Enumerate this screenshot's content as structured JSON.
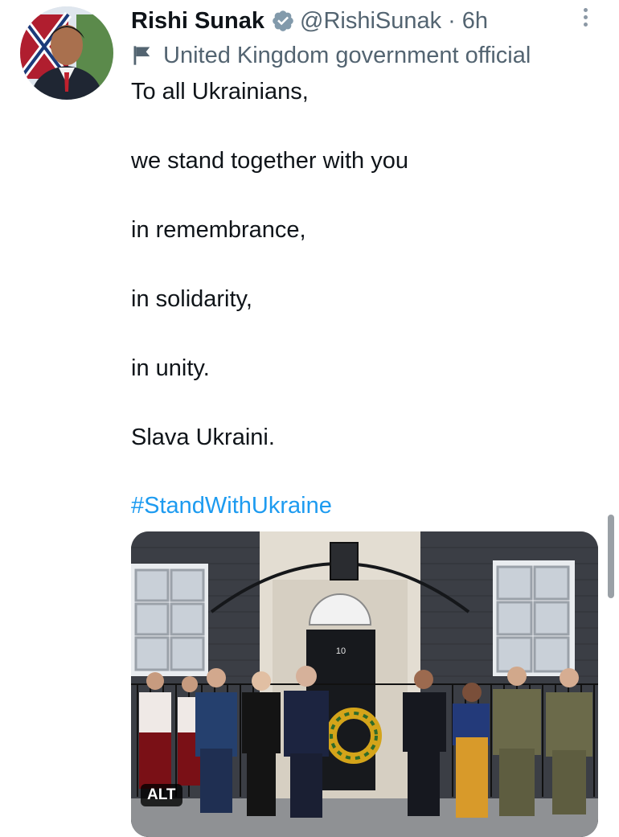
{
  "tweet": {
    "display_name": "Rishi Sunak",
    "handle": "@RishiSunak",
    "separator": "·",
    "time": "6h",
    "official_label": "United Kingdom government official",
    "lines": [
      "To all Ukrainians,",
      "we stand together with you",
      "in remembrance,",
      "in solidarity,",
      "in unity.",
      "Slava Ukraini."
    ],
    "hashtag": "#StandWithUkraine",
    "media": {
      "alt_badge": "ALT",
      "door_number": "10"
    }
  },
  "icons": {
    "verified": "verified-badge-icon",
    "official": "flag-icon",
    "more": "more-options-icon"
  },
  "colors": {
    "link": "#1d9bf0",
    "verified": "#829aab",
    "secondary": "#536471"
  }
}
